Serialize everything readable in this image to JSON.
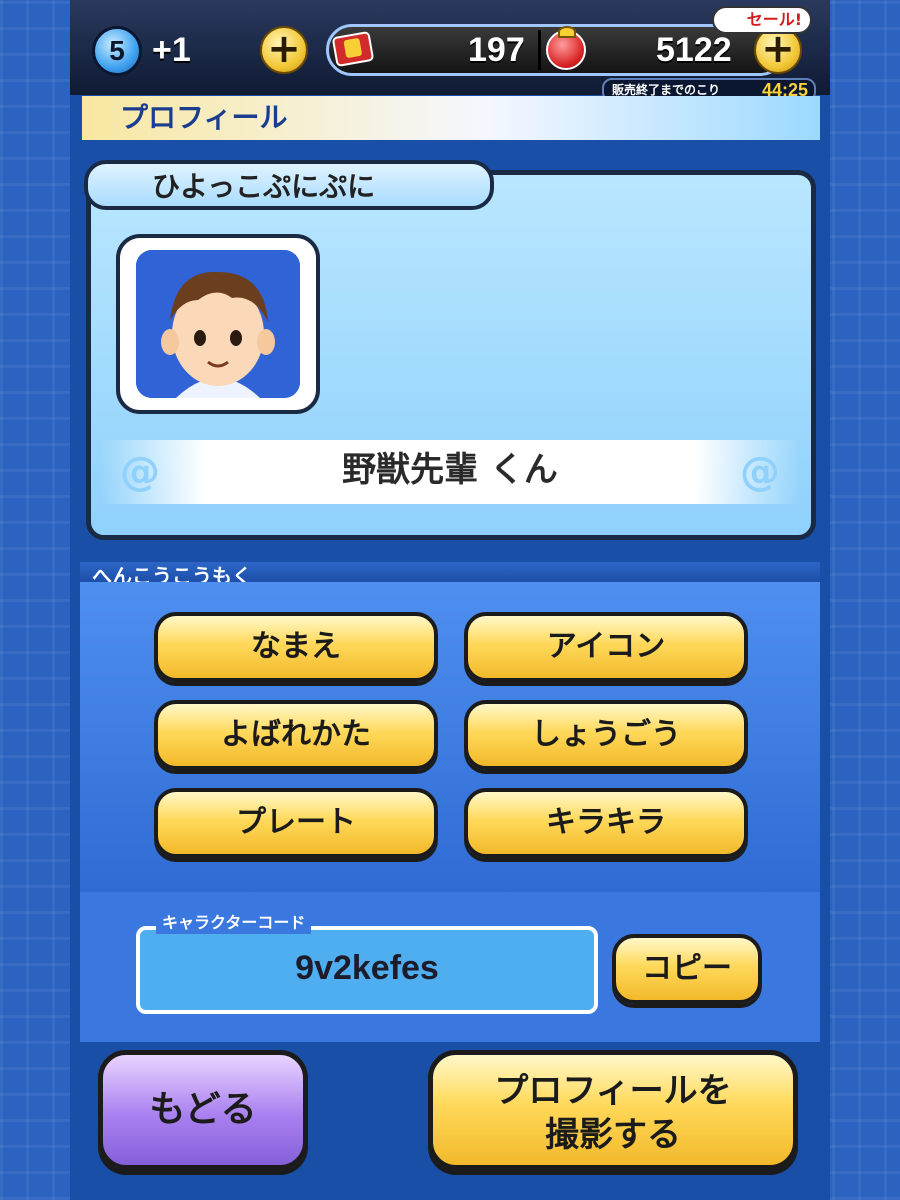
{
  "status_bar": {
    "level": "5",
    "stamina_bonus": "+1",
    "ticket_count": "197",
    "coin_count": "5122",
    "sale_badge": "セール!",
    "timer_label": "販売終了までのこり",
    "timer_value": "44:25"
  },
  "screen_title": "プロフィール",
  "profile": {
    "name_tab": "ひよっこぷにぷに",
    "nickname": "野獣先輩 くん",
    "avatar": "boy-avatar-icon"
  },
  "edit_section": {
    "label": "へんこうこうもく",
    "buttons": [
      {
        "label": "なまえ"
      },
      {
        "label": "アイコン"
      },
      {
        "label": "よばれかた"
      },
      {
        "label": "しょうごう"
      },
      {
        "label": "プレート"
      },
      {
        "label": "キラキラ"
      }
    ]
  },
  "character_code": {
    "label": "キャラクターコード",
    "value": "9v2kefes",
    "copy_label": "コピー"
  },
  "bottom": {
    "back_label": "もどる",
    "shoot_line1": "プロフィールを",
    "shoot_line2": "撮影する"
  },
  "colors": {
    "panel_blue": "#1a4fa8",
    "button_yellow": "#ffd95a",
    "back_purple": "#a980f0"
  }
}
